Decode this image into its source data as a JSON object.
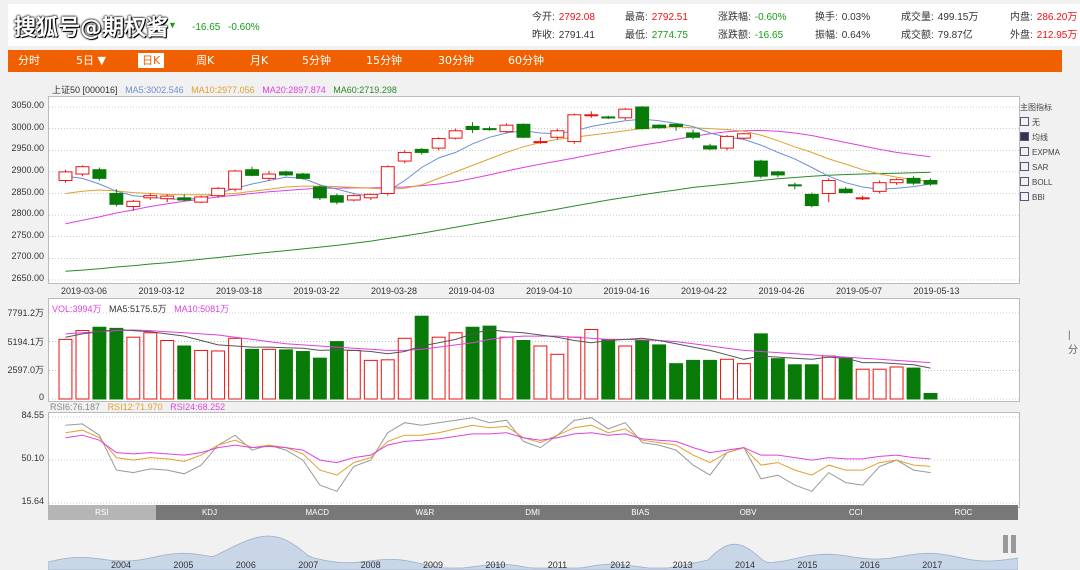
{
  "quote": {
    "watermark": "搜狐号@期权酱",
    "change": "-16.65",
    "change_pct": "-0.60%",
    "fields": [
      {
        "label": "今开:",
        "value": "2792.08",
        "color": "red",
        "x": 532,
        "y": 8
      },
      {
        "label": "昨收:",
        "value": "2791.41",
        "color": "normal",
        "x": 532,
        "y": 26
      },
      {
        "label": "最高:",
        "value": "2792.51",
        "color": "red",
        "x": 625,
        "y": 8
      },
      {
        "label": "最低:",
        "value": "2774.75",
        "color": "green",
        "x": 625,
        "y": 26
      },
      {
        "label": "涨跌幅:",
        "value": "-0.60%",
        "color": "green",
        "x": 718,
        "y": 8
      },
      {
        "label": "涨跌额:",
        "value": "-16.65",
        "color": "green",
        "x": 718,
        "y": 26
      },
      {
        "label": "换手:",
        "value": "0.03%",
        "color": "normal",
        "x": 815,
        "y": 8
      },
      {
        "label": "振幅:",
        "value": "0.64%",
        "color": "normal",
        "x": 815,
        "y": 26
      },
      {
        "label": "成交量:",
        "value": "499.15万",
        "color": "normal",
        "x": 901,
        "y": 8
      },
      {
        "label": "成交额:",
        "value": "79.87亿",
        "color": "normal",
        "x": 901,
        "y": 26
      },
      {
        "label": "内盘:",
        "value": "286.20万",
        "color": "red",
        "x": 1010,
        "y": 8
      },
      {
        "label": "外盘:",
        "value": "212.95万",
        "color": "red",
        "x": 1010,
        "y": 26
      }
    ]
  },
  "tabs": [
    "分时",
    "5日 ▼",
    "日K",
    "周K",
    "月K",
    "5分钟",
    "15分钟",
    "30分钟",
    "60分钟"
  ],
  "active_tab": 2,
  "legend1": {
    "name": "上证50 [000016]",
    "ma5": "MA5:3002.546",
    "ma10": "MA10:2977.056",
    "ma20": "MA20:2897.874",
    "ma60": "MA60:2719.298"
  },
  "legend2": {
    "vol": "VOL:3994万",
    "ma5": "MA5:5175.5万",
    "ma10": "MA10:5081万"
  },
  "legend3": {
    "rsi6": "RSI6:76.187",
    "rsi12": "RSI12:71.970",
    "rsi24": "RSI24:68.252"
  },
  "colors": {
    "up": "#e11",
    "down": "#087a08",
    "ma5": "#6a8fd8",
    "ma10": "#e0a030",
    "ma20": "#e040e0",
    "ma60": "#2a8a2a"
  },
  "side": {
    "title": "主图指标",
    "options": [
      "无",
      "均线",
      "EXPMA",
      "SAR",
      "BOLL",
      "BBI"
    ],
    "selected": 1
  },
  "indicator_tabs": [
    "RSI",
    "KDJ",
    "MACD",
    "W&R",
    "DMI",
    "BIAS",
    "OBV",
    "CCI",
    "ROC"
  ],
  "active_indicator": 0,
  "years": [
    "2004",
    "2005",
    "2006",
    "2007",
    "2008",
    "2009",
    "2010",
    "2011",
    "2012",
    "2013",
    "2014",
    "2015",
    "2016",
    "2017"
  ],
  "chart_data": {
    "type": "candlestick",
    "title": "上证50 [000016]",
    "dates_shown": [
      "2019-03-06",
      "2019-03-12",
      "2019-03-18",
      "2019-03-22",
      "2019-03-28",
      "2019-04-03",
      "2019-04-10",
      "2019-04-16",
      "2019-04-22",
      "2019-04-26",
      "2019-05-07",
      "2019-05-13"
    ],
    "ylim": [
      2650,
      3050
    ],
    "yticks": [
      "3050.00",
      "3000.00",
      "2950.00",
      "2900.00",
      "2850.00",
      "2800.00",
      "2750.00",
      "2700.00",
      "2650.00"
    ],
    "ohlc": [
      [
        2880,
        2905,
        2875,
        2900
      ],
      [
        2895,
        2915,
        2890,
        2912
      ],
      [
        2905,
        2910,
        2880,
        2885
      ],
      [
        2850,
        2860,
        2820,
        2825
      ],
      [
        2820,
        2835,
        2810,
        2832
      ],
      [
        2840,
        2850,
        2835,
        2845
      ],
      [
        2838,
        2848,
        2830,
        2844
      ],
      [
        2840,
        2848,
        2832,
        2835
      ],
      [
        2830,
        2845,
        2828,
        2842
      ],
      [
        2845,
        2865,
        2840,
        2862
      ],
      [
        2860,
        2905,
        2855,
        2902
      ],
      [
        2905,
        2912,
        2890,
        2892
      ],
      [
        2885,
        2902,
        2880,
        2895
      ],
      [
        2900,
        2903,
        2890,
        2893
      ],
      [
        2895,
        2898,
        2882,
        2885
      ],
      [
        2865,
        2868,
        2835,
        2840
      ],
      [
        2845,
        2850,
        2825,
        2830
      ],
      [
        2835,
        2848,
        2832,
        2845
      ],
      [
        2840,
        2850,
        2835,
        2848
      ],
      [
        2850,
        2915,
        2845,
        2912
      ],
      [
        2925,
        2950,
        2920,
        2945
      ],
      [
        2952,
        2955,
        2940,
        2945
      ],
      [
        2955,
        2980,
        2950,
        2977
      ],
      [
        2978,
        3000,
        2975,
        2995
      ],
      [
        3005,
        3015,
        2990,
        2998
      ],
      [
        3000,
        3005,
        2995,
        2998
      ],
      [
        2993,
        3012,
        2990,
        3008
      ],
      [
        3010,
        3012,
        2978,
        2980
      ],
      [
        2970,
        2980,
        2965,
        2970
      ],
      [
        2980,
        3000,
        2975,
        2995
      ],
      [
        2970,
        3035,
        2965,
        3032
      ],
      [
        3030,
        3040,
        3025,
        3032
      ],
      [
        3027,
        3030,
        3022,
        3025
      ],
      [
        3025,
        3048,
        3020,
        3045
      ],
      [
        3050,
        3052,
        2998,
        3000
      ],
      [
        3008,
        3010,
        3000,
        3002
      ],
      [
        3010,
        3012,
        2995,
        3005
      ],
      [
        2990,
        2998,
        2975,
        2980
      ],
      [
        2960,
        2965,
        2950,
        2953
      ],
      [
        2955,
        2985,
        2950,
        2982
      ],
      [
        2978,
        2990,
        2975,
        2988
      ],
      [
        2925,
        2928,
        2885,
        2890
      ],
      [
        2900,
        2902,
        2888,
        2893
      ],
      [
        2870,
        2875,
        2860,
        2868
      ],
      [
        2848,
        2852,
        2818,
        2822
      ],
      [
        2850,
        2885,
        2830,
        2880
      ],
      [
        2860,
        2865,
        2850,
        2852
      ],
      [
        2838,
        2845,
        2835,
        2840
      ],
      [
        2855,
        2880,
        2850,
        2875
      ],
      [
        2875,
        2885,
        2870,
        2882
      ],
      [
        2885,
        2890,
        2870,
        2874
      ],
      [
        2880,
        2885,
        2868,
        2872
      ]
    ],
    "ma5": [
      2890,
      2885,
      2872,
      2855,
      2845,
      2842,
      2838,
      2836,
      2840,
      2850,
      2862,
      2872,
      2880,
      2888,
      2885,
      2870,
      2860,
      2850,
      2843,
      2855,
      2880,
      2910,
      2932,
      2945,
      2965,
      2980,
      2990,
      2995,
      2990,
      2988,
      2995,
      3005,
      3012,
      3018,
      3022,
      3018,
      3012,
      3005,
      2990,
      2980,
      2975,
      2962,
      2945,
      2930,
      2910,
      2890,
      2875,
      2865,
      2860,
      2862,
      2866,
      2872
    ],
    "ma10": [
      2850,
      2855,
      2858,
      2856,
      2852,
      2850,
      2848,
      2847,
      2847,
      2848,
      2850,
      2855,
      2860,
      2865,
      2867,
      2867,
      2866,
      2864,
      2862,
      2860,
      2862,
      2870,
      2885,
      2900,
      2915,
      2930,
      2945,
      2958,
      2968,
      2975,
      2980,
      2985,
      2990,
      2995,
      3000,
      3003,
      3004,
      3002,
      3000,
      2998,
      2994,
      2985,
      2972,
      2958,
      2945,
      2930,
      2918,
      2905,
      2895,
      2888,
      2882,
      2878
    ],
    "ma20": [
      2780,
      2788,
      2796,
      2805,
      2812,
      2820,
      2826,
      2832,
      2837,
      2842,
      2846,
      2850,
      2854,
      2857,
      2860,
      2862,
      2862,
      2863,
      2863,
      2864,
      2865,
      2868,
      2872,
      2877,
      2885,
      2893,
      2902,
      2910,
      2918,
      2925,
      2932,
      2940,
      2947,
      2955,
      2962,
      2968,
      2975,
      2982,
      2988,
      2993,
      2995,
      2996,
      2994,
      2990,
      2984,
      2976,
      2968,
      2960,
      2952,
      2945,
      2940,
      2935
    ],
    "ma60": [
      2670,
      2673,
      2676,
      2680,
      2683,
      2687,
      2690,
      2694,
      2698,
      2702,
      2706,
      2710,
      2714,
      2718,
      2722,
      2726,
      2730,
      2735,
      2740,
      2746,
      2752,
      2758,
      2765,
      2772,
      2779,
      2786,
      2793,
      2800,
      2807,
      2814,
      2821,
      2828,
      2835,
      2841,
      2847,
      2853,
      2858,
      2864,
      2868,
      2872,
      2876,
      2880,
      2884,
      2887,
      2890,
      2892,
      2894,
      2895,
      2896,
      2897,
      2898,
      2899
    ],
    "volume": {
      "ylim": [
        0,
        7791.2
      ],
      "yticks": [
        "7791.2万",
        "5194.1万",
        "2597.0万",
        "0"
      ],
      "values": [
        5400,
        6200,
        6500,
        6400,
        5600,
        6000,
        5300,
        4800,
        4400,
        4350,
        5500,
        4500,
        4500,
        4450,
        4300,
        3700,
        5200,
        4400,
        3500,
        3550,
        5500,
        7500,
        5600,
        6000,
        6500,
        6600,
        5600,
        5300,
        4800,
        4050,
        5600,
        6300,
        5400,
        4800,
        5300,
        4900,
        3200,
        3500,
        3500,
        3600,
        3200,
        5900,
        3650,
        3100,
        3100,
        3900,
        3700,
        2700,
        2700,
        2900,
        2800,
        500
      ],
      "ma5": [
        5600,
        5900,
        6100,
        6300,
        6200,
        6100,
        5900,
        5700,
        5300,
        4900,
        4800,
        4700,
        4700,
        4650,
        4600,
        4400,
        4450,
        4400,
        4300,
        4100,
        4300,
        4800,
        5100,
        5400,
        5900,
        6300,
        6100,
        6000,
        5800,
        5600,
        5300,
        5100,
        5300,
        5400,
        5500,
        5300,
        5000,
        4700,
        4400,
        4000,
        3600,
        3900,
        3800,
        3700,
        3600,
        3800,
        3700,
        3300,
        3300,
        3200,
        3100,
        2800
      ],
      "ma10": [
        5900,
        6000,
        6100,
        6200,
        6250,
        6200,
        6100,
        6000,
        5900,
        5800,
        5600,
        5400,
        5200,
        5000,
        4900,
        4800,
        4700,
        4600,
        4500,
        4400,
        4400,
        4500,
        4700,
        4900,
        5100,
        5400,
        5600,
        5700,
        5700,
        5700,
        5600,
        5500,
        5400,
        5400,
        5350,
        5300,
        5200,
        5000,
        4800,
        4600,
        4400,
        4300,
        4200,
        4100,
        4000,
        3900,
        3800,
        3700,
        3600,
        3500,
        3400,
        3300
      ]
    },
    "rsi": {
      "ylim": [
        15.64,
        84.55
      ],
      "yticks": [
        "84.55",
        "50.10",
        "15.64"
      ],
      "rsi6": [
        78,
        79,
        70,
        42,
        40,
        43,
        42,
        39,
        46,
        62,
        70,
        58,
        62,
        58,
        50,
        30,
        25,
        45,
        50,
        72,
        80,
        78,
        80,
        82,
        84,
        80,
        82,
        65,
        60,
        70,
        82,
        84,
        75,
        80,
        64,
        62,
        58,
        46,
        38,
        56,
        60,
        35,
        38,
        30,
        25,
        40,
        32,
        30,
        45,
        50,
        42,
        40
      ],
      "rsi12": [
        72,
        74,
        68,
        52,
        50,
        52,
        51,
        49,
        54,
        62,
        66,
        60,
        62,
        60,
        55,
        42,
        38,
        48,
        52,
        65,
        70,
        70,
        72,
        75,
        78,
        76,
        77,
        68,
        64,
        70,
        76,
        78,
        72,
        75,
        66,
        64,
        62,
        54,
        48,
        56,
        60,
        46,
        48,
        42,
        38,
        46,
        42,
        42,
        48,
        50,
        46,
        45
      ],
      "rsi24": [
        68,
        70,
        66,
        56,
        55,
        56,
        55,
        54,
        56,
        60,
        62,
        60,
        61,
        60,
        58,
        50,
        48,
        52,
        54,
        62,
        65,
        66,
        67,
        69,
        71,
        71,
        72,
        68,
        66,
        68,
        71,
        72,
        70,
        71,
        67,
        66,
        65,
        60,
        56,
        58,
        60,
        54,
        54,
        52,
        50,
        52,
        51,
        51,
        53,
        54,
        52,
        51
      ]
    }
  }
}
